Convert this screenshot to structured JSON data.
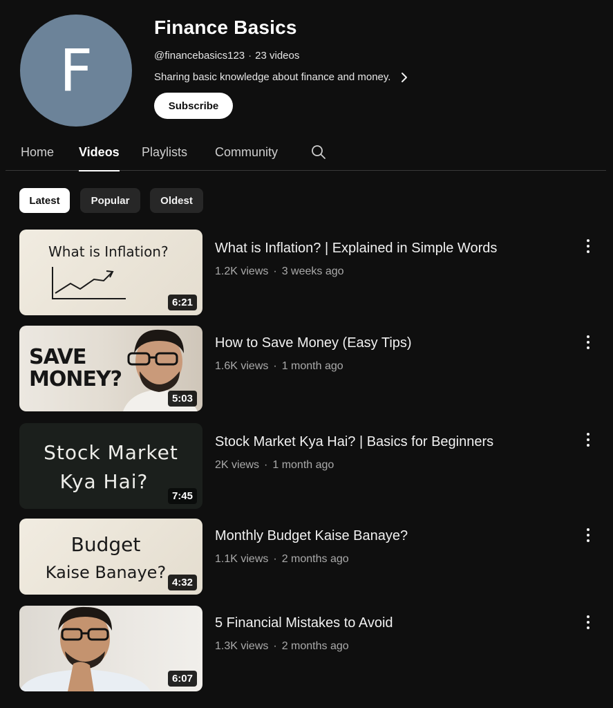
{
  "channel": {
    "avatar_letter": "F",
    "avatar_color": "#6c8399",
    "name": "Finance Basics",
    "handle": "@financebasics123",
    "video_count": "23 videos",
    "description": "Sharing basic knowledge about finance and money.",
    "subscribe_label": "Subscribe"
  },
  "tabs": [
    {
      "label": "Home",
      "active": false
    },
    {
      "label": "Videos",
      "active": true
    },
    {
      "label": "Playlists",
      "active": false
    },
    {
      "label": "Community",
      "active": false
    }
  ],
  "filters": [
    {
      "label": "Latest",
      "selected": true
    },
    {
      "label": "Popular",
      "selected": false
    },
    {
      "label": "Oldest",
      "selected": false
    }
  ],
  "videos": [
    {
      "title": "What is Inflation? | Explained in Simple Words",
      "views": "1.2K views",
      "age": "3 weeks ago",
      "duration": "6:21",
      "thumb_text": [
        "What is Inflation?"
      ]
    },
    {
      "title": "How to Save Money (Easy Tips)",
      "views": "1.6K views",
      "age": "1 month ago",
      "duration": "5:03",
      "thumb_text": [
        "SAVE",
        "MONEY?"
      ]
    },
    {
      "title": "Stock Market Kya Hai? | Basics for Beginners",
      "views": "2K views",
      "age": "1 month ago",
      "duration": "7:45",
      "thumb_text": [
        "Stock Market",
        "Kya Hai?"
      ]
    },
    {
      "title": "Monthly Budget Kaise Banaye?",
      "views": "1.1K views",
      "age": "2 months ago",
      "duration": "4:32",
      "thumb_text": [
        "Budget",
        "Kaise Banaye?"
      ]
    },
    {
      "title": "5 Financial Mistakes to Avoid",
      "views": "1.3K views",
      "age": "2 months ago",
      "duration": "6:07",
      "thumb_text": []
    }
  ],
  "icons": {
    "tabs_search": "search-icon",
    "description_more": "chevron-right-icon",
    "video_options": "more-vertical-icon"
  },
  "colors": {
    "background": "#0f0f0f",
    "text_primary": "#f1f1f1",
    "text_secondary": "#aaaaaa",
    "chip_selected": "#ffffff",
    "chip_unselected": "#272727"
  }
}
